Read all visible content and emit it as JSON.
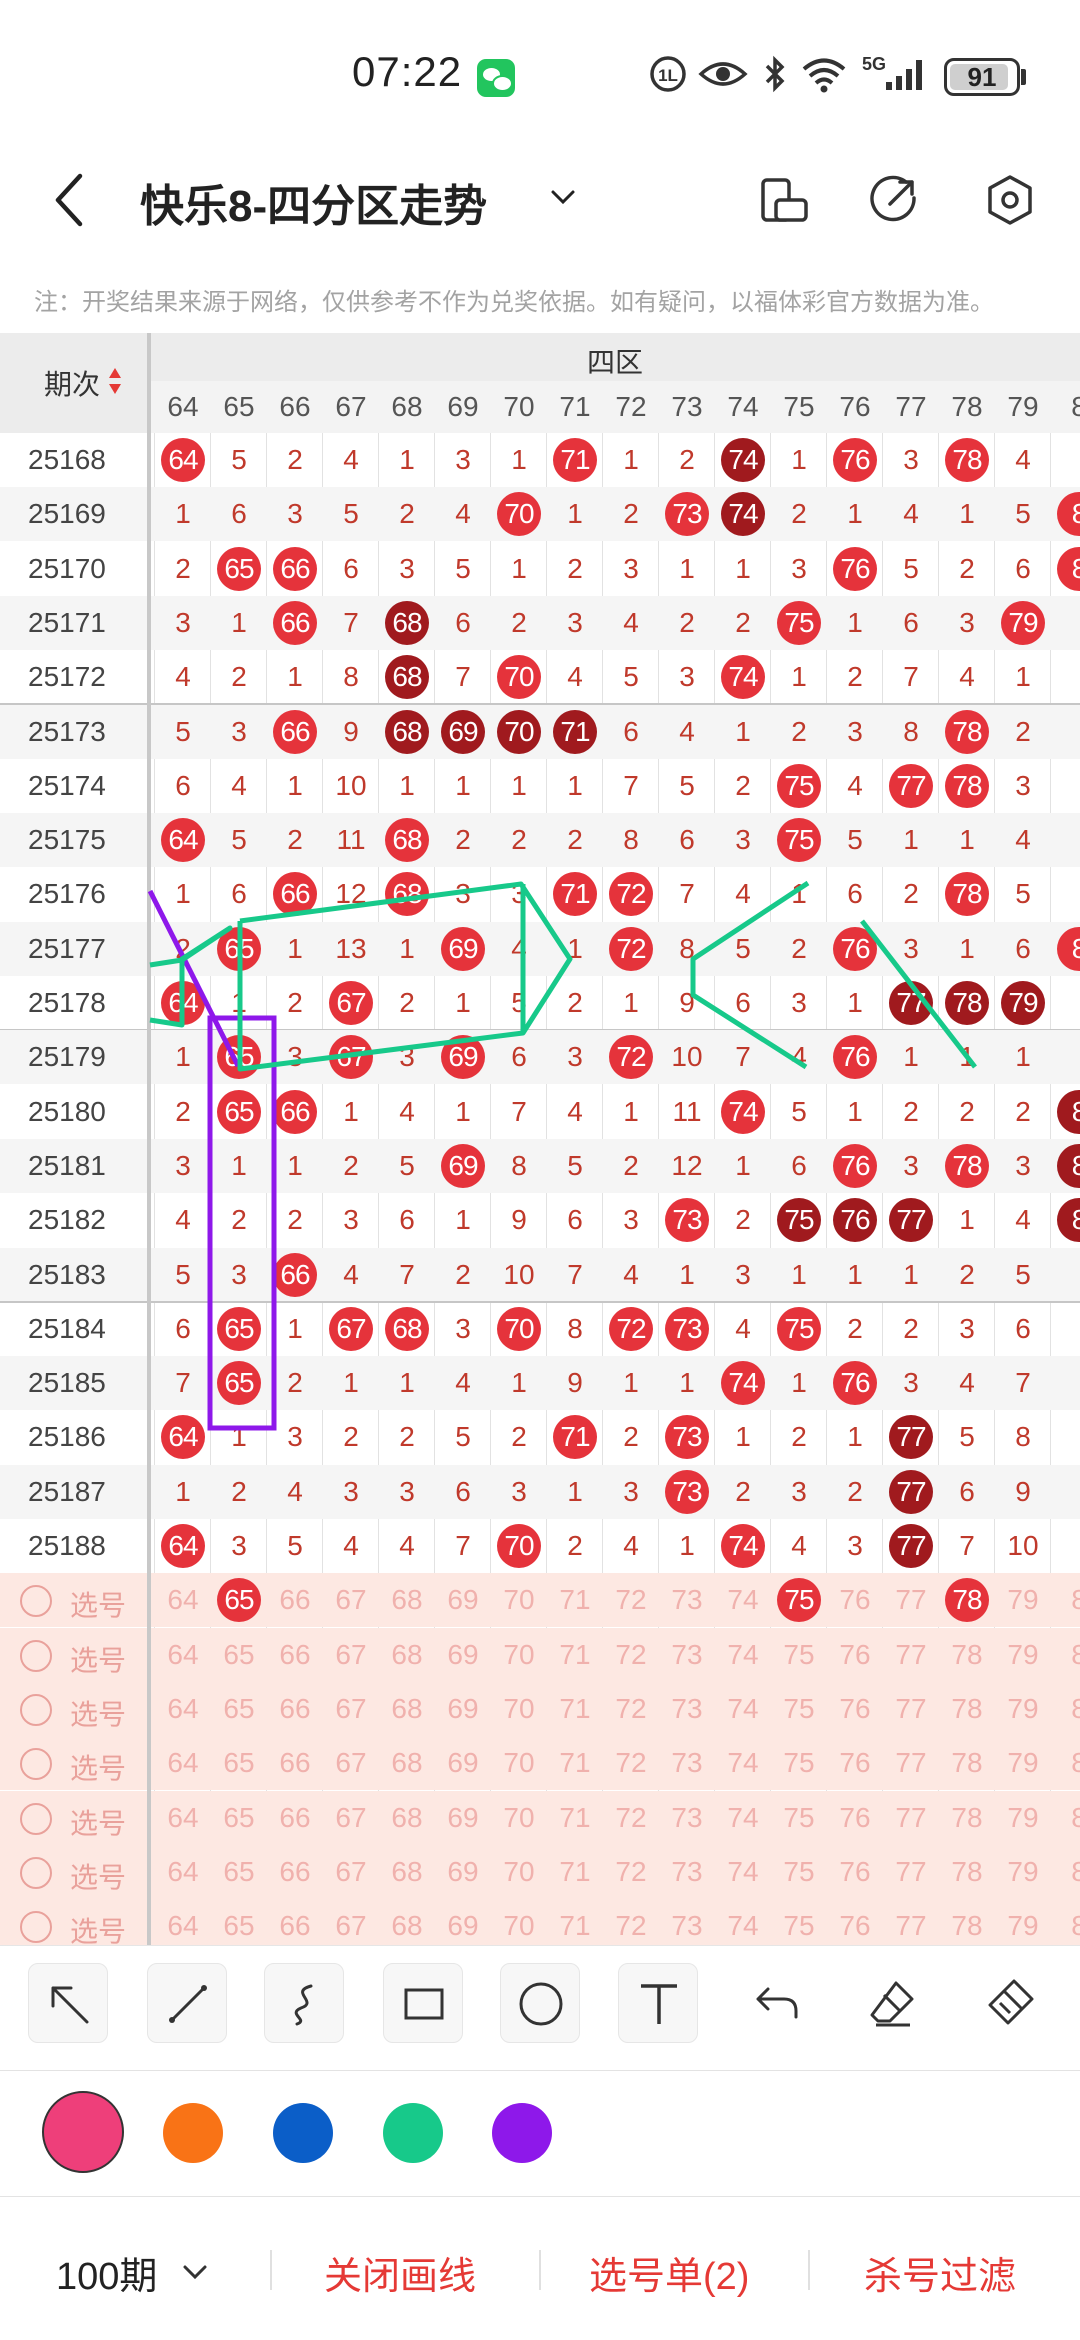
{
  "status": {
    "time": "07:22",
    "battery": "91",
    "battery_level": 0.91,
    "network": "5G"
  },
  "header": {
    "title": "快乐8-四分区走势"
  },
  "note": "注：开奖结果来源于网络，仅供参考不作为兑奖依据。如有疑问，以福体彩官方数据为准。",
  "table": {
    "issue_header": "期次",
    "zone_header": "四区",
    "numbers": [
      "64",
      "65",
      "66",
      "67",
      "68",
      "69",
      "70",
      "71",
      "72",
      "73",
      "74",
      "75",
      "76",
      "77",
      "78",
      "79",
      "8"
    ],
    "rows": [
      {
        "issue": "25168",
        "cells": [
          "64",
          "5",
          "2",
          "4",
          "1",
          "3",
          "1",
          "71",
          "1",
          "2",
          "74",
          "1",
          "76",
          "3",
          "78",
          "4",
          ""
        ],
        "hits": [
          0,
          7,
          10,
          12,
          14
        ],
        "dark": [
          10
        ]
      },
      {
        "issue": "25169",
        "cells": [
          "1",
          "6",
          "3",
          "5",
          "2",
          "4",
          "70",
          "1",
          "2",
          "73",
          "74",
          "2",
          "1",
          "4",
          "1",
          "5",
          "8"
        ],
        "hits": [
          6,
          9,
          10,
          16
        ],
        "dark": [
          10
        ]
      },
      {
        "issue": "25170",
        "cells": [
          "2",
          "65",
          "66",
          "6",
          "3",
          "5",
          "1",
          "2",
          "3",
          "1",
          "1",
          "3",
          "76",
          "5",
          "2",
          "6",
          "8"
        ],
        "hits": [
          1,
          2,
          12,
          16
        ],
        "dark": []
      },
      {
        "issue": "25171",
        "cells": [
          "3",
          "1",
          "66",
          "7",
          "68",
          "6",
          "2",
          "3",
          "4",
          "2",
          "2",
          "75",
          "1",
          "6",
          "3",
          "79",
          ""
        ],
        "hits": [
          2,
          4,
          11,
          15
        ],
        "dark": [
          4
        ]
      },
      {
        "issue": "25172",
        "cells": [
          "4",
          "2",
          "1",
          "8",
          "68",
          "7",
          "70",
          "4",
          "5",
          "3",
          "74",
          "1",
          "2",
          "7",
          "4",
          "1",
          ""
        ],
        "hits": [
          4,
          6,
          10
        ],
        "dark": [
          4
        ]
      },
      {
        "issue": "25173",
        "cells": [
          "5",
          "3",
          "66",
          "9",
          "68",
          "69",
          "70",
          "71",
          "6",
          "4",
          "1",
          "2",
          "3",
          "8",
          "78",
          "2",
          ""
        ],
        "hits": [
          2,
          4,
          5,
          6,
          7,
          14
        ],
        "dark": [
          4,
          5,
          6,
          7
        ]
      },
      {
        "issue": "25174",
        "cells": [
          "6",
          "4",
          "1",
          "10",
          "1",
          "1",
          "1",
          "1",
          "7",
          "5",
          "2",
          "75",
          "4",
          "77",
          "78",
          "3",
          ""
        ],
        "hits": [
          11,
          13,
          14
        ],
        "dark": []
      },
      {
        "issue": "25175",
        "cells": [
          "64",
          "5",
          "2",
          "11",
          "68",
          "2",
          "2",
          "2",
          "8",
          "6",
          "3",
          "75",
          "5",
          "1",
          "1",
          "4",
          ""
        ],
        "hits": [
          0,
          4,
          11
        ],
        "dark": []
      },
      {
        "issue": "25176",
        "cells": [
          "1",
          "6",
          "66",
          "12",
          "68",
          "3",
          "3",
          "71",
          "72",
          "7",
          "4",
          "1",
          "6",
          "2",
          "78",
          "5",
          ""
        ],
        "hits": [
          2,
          4,
          7,
          8,
          14
        ],
        "dark": []
      },
      {
        "issue": "25177",
        "cells": [
          "2",
          "65",
          "1",
          "13",
          "1",
          "69",
          "4",
          "1",
          "72",
          "8",
          "5",
          "2",
          "76",
          "3",
          "1",
          "6",
          "8"
        ],
        "hits": [
          1,
          5,
          8,
          12,
          16
        ],
        "dark": []
      },
      {
        "issue": "25178",
        "cells": [
          "64",
          "1",
          "2",
          "67",
          "2",
          "1",
          "5",
          "2",
          "1",
          "9",
          "6",
          "3",
          "1",
          "77",
          "78",
          "79",
          ""
        ],
        "hits": [
          0,
          3,
          13,
          14,
          15
        ],
        "dark": [
          13,
          14,
          15
        ]
      },
      {
        "issue": "25179",
        "cells": [
          "1",
          "65",
          "3",
          "67",
          "3",
          "69",
          "6",
          "3",
          "72",
          "10",
          "7",
          "4",
          "76",
          "1",
          "1",
          "1",
          ""
        ],
        "hits": [
          1,
          3,
          5,
          8,
          12
        ],
        "dark": []
      },
      {
        "issue": "25180",
        "cells": [
          "2",
          "65",
          "66",
          "1",
          "4",
          "1",
          "7",
          "4",
          "1",
          "11",
          "74",
          "5",
          "1",
          "2",
          "2",
          "2",
          "8"
        ],
        "hits": [
          1,
          2,
          10,
          16
        ],
        "dark": [
          16
        ]
      },
      {
        "issue": "25181",
        "cells": [
          "3",
          "1",
          "1",
          "2",
          "5",
          "69",
          "8",
          "5",
          "2",
          "12",
          "1",
          "6",
          "76",
          "3",
          "78",
          "3",
          "8"
        ],
        "hits": [
          5,
          12,
          14,
          16
        ],
        "dark": [
          16
        ]
      },
      {
        "issue": "25182",
        "cells": [
          "4",
          "2",
          "2",
          "3",
          "6",
          "1",
          "9",
          "6",
          "3",
          "73",
          "2",
          "75",
          "76",
          "77",
          "1",
          "4",
          "8"
        ],
        "hits": [
          9,
          11,
          12,
          13,
          16
        ],
        "dark": [
          11,
          12,
          13,
          16
        ]
      },
      {
        "issue": "25183",
        "cells": [
          "5",
          "3",
          "66",
          "4",
          "7",
          "2",
          "10",
          "7",
          "4",
          "1",
          "3",
          "1",
          "1",
          "1",
          "2",
          "5",
          ""
        ],
        "hits": [
          2
        ],
        "dark": []
      },
      {
        "issue": "25184",
        "cells": [
          "6",
          "65",
          "1",
          "67",
          "68",
          "3",
          "70",
          "8",
          "72",
          "73",
          "4",
          "75",
          "2",
          "2",
          "3",
          "6",
          ""
        ],
        "hits": [
          1,
          3,
          4,
          6,
          8,
          9,
          11
        ],
        "dark": []
      },
      {
        "issue": "25185",
        "cells": [
          "7",
          "65",
          "2",
          "1",
          "1",
          "4",
          "1",
          "9",
          "1",
          "1",
          "74",
          "1",
          "76",
          "3",
          "4",
          "7",
          ""
        ],
        "hits": [
          1,
          10,
          12
        ],
        "dark": []
      },
      {
        "issue": "25186",
        "cells": [
          "64",
          "1",
          "3",
          "2",
          "2",
          "5",
          "2",
          "71",
          "2",
          "73",
          "1",
          "2",
          "1",
          "77",
          "5",
          "8",
          ""
        ],
        "hits": [
          0,
          7,
          9,
          13
        ],
        "dark": [
          13
        ]
      },
      {
        "issue": "25187",
        "cells": [
          "1",
          "2",
          "4",
          "3",
          "3",
          "6",
          "3",
          "1",
          "3",
          "73",
          "2",
          "3",
          "2",
          "77",
          "6",
          "9",
          ""
        ],
        "hits": [
          9,
          13
        ],
        "dark": [
          13
        ]
      },
      {
        "issue": "25188",
        "cells": [
          "64",
          "3",
          "5",
          "4",
          "4",
          "7",
          "70",
          "2",
          "4",
          "1",
          "74",
          "4",
          "3",
          "77",
          "7",
          "10",
          ""
        ],
        "hits": [
          0,
          6,
          10,
          13
        ],
        "dark": [
          13
        ]
      }
    ],
    "select_label": "选号",
    "select_rows": 7,
    "select_hits": [
      [
        1,
        11,
        14
      ],
      [],
      [],
      [],
      [],
      [],
      []
    ]
  },
  "toolbar": [
    "arrow-tool-icon",
    "line-tool-icon",
    "curve-tool-icon",
    "rect-tool-icon",
    "circle-tool-icon",
    "text-tool-icon",
    "undo-icon",
    "eraser-icon",
    "clear-icon"
  ],
  "colors": [
    "#ee3f7a",
    "#f97316",
    "#0b5ec8",
    "#17c98a",
    "#8e18ea"
  ],
  "bottom": {
    "periods": "100期",
    "close_lines": "关闭画线",
    "selection": "选号单(2)",
    "filter": "杀号过滤"
  }
}
